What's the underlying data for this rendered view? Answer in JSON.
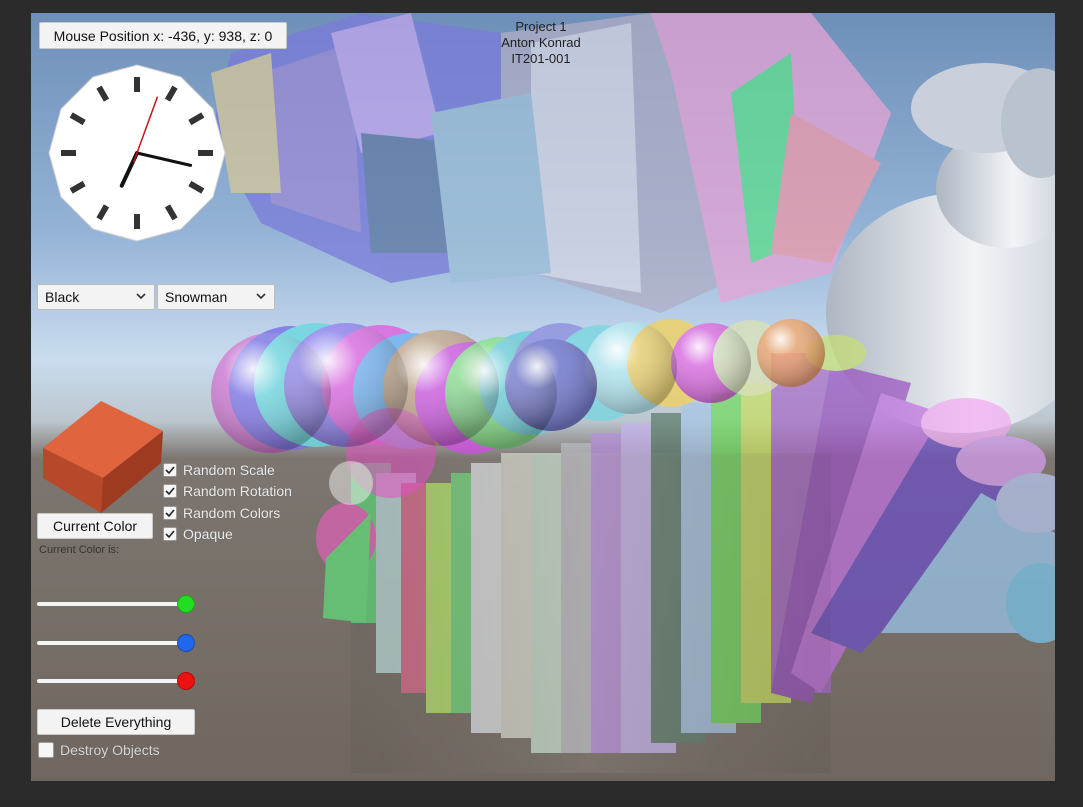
{
  "hud": {
    "mouse_position": "Mouse Position x: -436, y: 938, z: 0",
    "title_lines": [
      "Project 1",
      "Anton Konrad",
      "IT201-001"
    ]
  },
  "controls": {
    "color_select": {
      "selected": "Black"
    },
    "shape_select": {
      "selected": "Snowman"
    },
    "current_color_button": "Current Color",
    "current_color_label": "Current Color is:",
    "current_color_swatch": "#c4502e",
    "checkboxes": [
      {
        "label": "Random Scale",
        "checked": true
      },
      {
        "label": "Random Rotation",
        "checked": true
      },
      {
        "label": "Random Colors",
        "checked": true
      },
      {
        "label": "Opaque",
        "checked": true
      }
    ],
    "sliders": [
      {
        "name": "green",
        "value": 1.0,
        "color": "#22dd22"
      },
      {
        "name": "blue",
        "value": 1.0,
        "color": "#2266ee"
      },
      {
        "name": "red",
        "value": 1.0,
        "color": "#ee1111"
      }
    ],
    "delete_button": "Delete Everything",
    "destroy_checkbox": {
      "label": "Destroy Objects",
      "checked": false
    }
  },
  "clock": {
    "hour_hand_angle": 205,
    "minute_hand_angle": 103,
    "second_hand_angle": 20
  }
}
